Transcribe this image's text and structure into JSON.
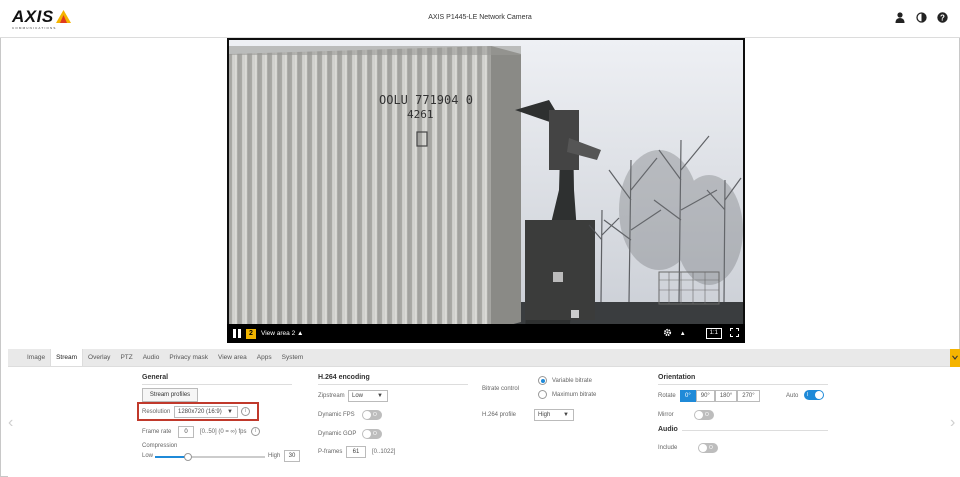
{
  "header": {
    "logo_text": "AXIS",
    "logo_sub": "COMMUNICATIONS",
    "title": "AXIS P1445-LE Network Camera"
  },
  "video": {
    "view_number": "2",
    "view_label": "View area 2 ▲",
    "ratio_label": "1:1",
    "container_text_1": "OOLU 771904 0",
    "container_text_2": "4261"
  },
  "tabs": [
    "Image",
    "Stream",
    "Overlay",
    "PTZ",
    "Audio",
    "Privacy mask",
    "View area",
    "Apps",
    "System"
  ],
  "active_tab": "Stream",
  "general": {
    "heading": "General",
    "stream_profiles": "Stream profiles",
    "resolution_label": "Resolution",
    "resolution_value": "1280x720 (16:9)",
    "frame_rate_label": "Frame rate",
    "frame_rate_value": "0",
    "frame_rate_hint": "[0..50] (0 = ∞) fps",
    "compression_label": "Compression",
    "low_label": "Low",
    "high_label": "High",
    "compression_value": "30",
    "compression_level": 0.3
  },
  "h264": {
    "heading": "H.264 encoding",
    "zipstream_label": "Zipstream",
    "zipstream_value": "Low",
    "dynamic_fps_label": "Dynamic FPS",
    "dynamic_gop_label": "Dynamic GOP",
    "pframes_label": "P-frames",
    "pframes_value": "61",
    "pframes_hint": "[0..1022]",
    "toggle_off_text": "O"
  },
  "bitrate": {
    "label": "Bitrate control",
    "variable": "Variable bitrate",
    "maximum": "Maximum bitrate",
    "profile_label": "H.264 profile",
    "profile_value": "High"
  },
  "orientation": {
    "heading": "Orientation",
    "rotate_label": "Rotate",
    "rotations": [
      "0°",
      "90°",
      "180°",
      "270°"
    ],
    "auto_label": "Auto",
    "auto_toggle_text": "I",
    "mirror_label": "Mirror",
    "audio_heading": "Audio",
    "include_label": "Include"
  },
  "colors": {
    "accent": "#1f8ad8",
    "brand_yellow": "#f5b400",
    "highlight_red": "#c0392b"
  }
}
